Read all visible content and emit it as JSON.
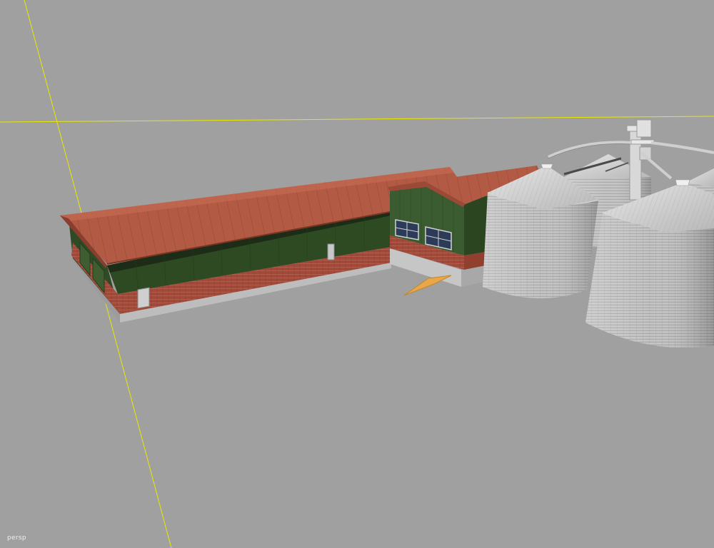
{
  "viewport": {
    "camera_label": "persp",
    "background_color": "#a0a0a0",
    "grid_line_color": "#e8e800"
  },
  "scene": {
    "objects": [
      "farm-building",
      "annex-building",
      "grain-silos",
      "grain-conveyor"
    ],
    "colors": {
      "roof": "#b25a44",
      "wall_green": "#2e4a22",
      "brick": "#a04838",
      "silo_metal": "#bcbcbc"
    }
  }
}
